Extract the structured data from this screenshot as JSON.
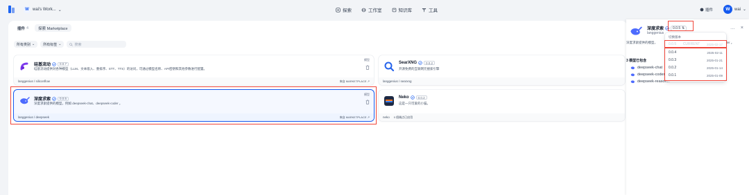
{
  "topbar": {
    "workspace_initial": "W",
    "workspace_name": "wai's Work...",
    "nav": [
      {
        "label": "探索",
        "icon": "explore-icon"
      },
      {
        "label": "工作室",
        "icon": "studio-icon"
      },
      {
        "label": "知识库",
        "icon": "knowledge-icon"
      },
      {
        "label": "工具",
        "icon": "tools-icon"
      }
    ],
    "plugin_label": "插件",
    "user_initial": "W",
    "user_name": "wai"
  },
  "tabs": {
    "plugins_label": "插件",
    "plugins_count": "4",
    "marketplace_label": "探索 Marketplace"
  },
  "filters": {
    "category": "所有类别",
    "tags": "所有标签",
    "search_placeholder": "搜索"
  },
  "cards": [
    {
      "title": "硅基流动",
      "version": "0.0.7",
      "desc": "硅基流动提供对各种模型（LLM、文本嵌入、重排序、STT、TTS）的访问，可通过模型名称、API密钥和其他参数进行配置。",
      "tag": "模型",
      "org": "langgenius / siliconflow",
      "link": "來自 MARKETPLACE ↗"
    },
    {
      "title": "SearXNG",
      "version": "0.0.2",
      "desc": "开源免费的互联网元搜索引擎",
      "tag": "",
      "org": "langgenius / searxng",
      "link": ""
    },
    {
      "title": "深度求索",
      "version": "0.0.5",
      "desc": "深度求索提供的模型，例如 deepseek-chat、deepseek-coder 。",
      "tag": "模型",
      "org": "langgenius / deepseek",
      "link": "來自 MARKETPLACE ↗"
    },
    {
      "title": "Neko",
      "version": "0.0.2",
      "desc": "这是一只可爱的小猫。",
      "tag": "",
      "org": "neko",
      "link": "0 個端点已启用"
    }
  ],
  "drawer": {
    "title": "深度求索",
    "version_button": "0.0.5",
    "subtitle": "langgenius",
    "desc": "深度求索提供的模型，",
    "desc_tail": "der 。",
    "models_title": "3 模型已包含",
    "models": [
      "deepseek-chat",
      "deepseek-coder",
      "deepseek-reasoner"
    ],
    "dropdown_header": "切换版本",
    "current_tag": "CURRENT",
    "versions": [
      {
        "version": "0.0.5",
        "date": "2025-02-17",
        "current": true
      },
      {
        "version": "0.0.4",
        "date": "2025-02-11",
        "current": false
      },
      {
        "version": "0.0.3",
        "date": "2025-01-21",
        "current": false
      },
      {
        "version": "0.0.2",
        "date": "2025-01-14",
        "current": false
      },
      {
        "version": "0.0.1",
        "date": "2025-01-09",
        "current": false
      }
    ]
  },
  "colors": {
    "accent": "#155aef",
    "highlight_box": "#f04438",
    "background": "#f2f4f7"
  }
}
